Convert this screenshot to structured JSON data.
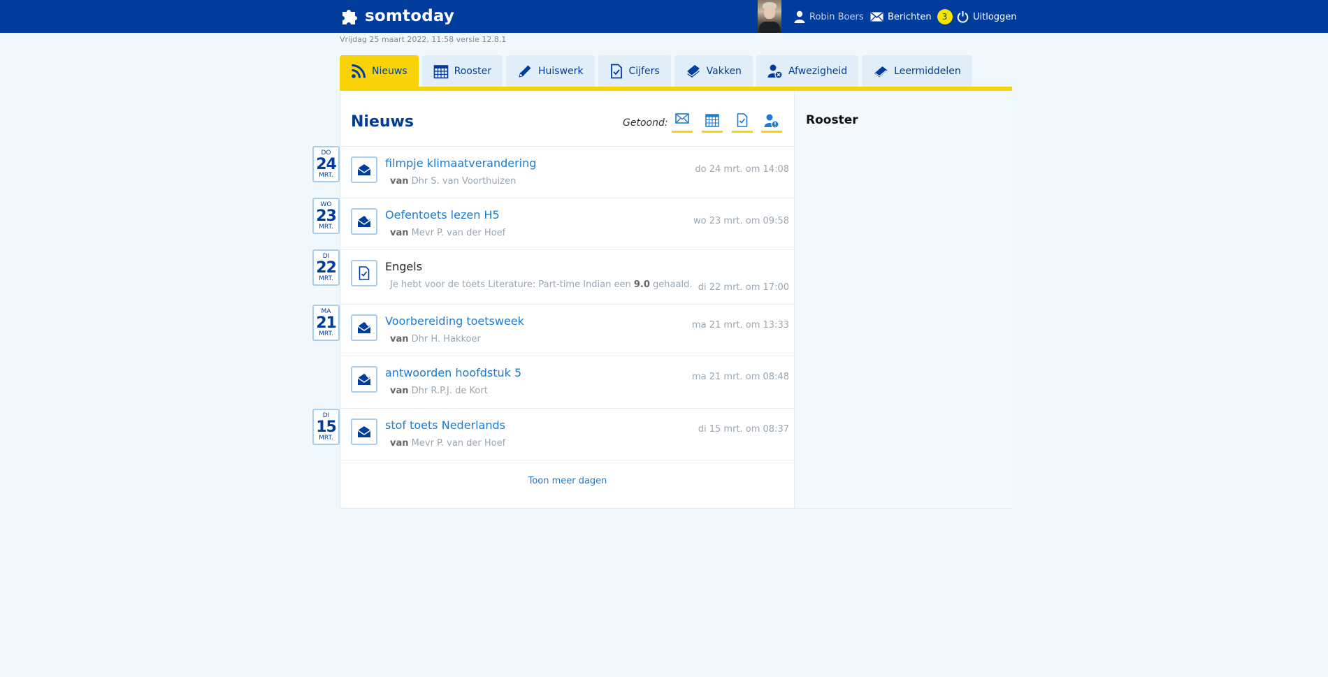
{
  "app": {
    "brand": "somtoday",
    "colors": {
      "primary": "#003c9c",
      "accent": "#f7d307",
      "link": "#1b7ad2",
      "background": "#f1f8fc"
    }
  },
  "header": {
    "user_name": "Robin Boers",
    "messages_label": "Berichten",
    "messages_count": "3",
    "logout_label": "Uitloggen",
    "icons": {
      "user": "user-icon",
      "messages": "envelope-icon",
      "logout": "power-icon"
    }
  },
  "meta_line": "Vrijdag 25 maart 2022, 11:58 versie 12.8.1",
  "tabs": [
    {
      "label": "Nieuws",
      "icon": "rss-icon",
      "active": true
    },
    {
      "label": "Rooster",
      "icon": "calendar-icon",
      "active": false
    },
    {
      "label": "Huiswerk",
      "icon": "pencil-icon",
      "active": false
    },
    {
      "label": "Cijfers",
      "icon": "grade-doc-icon",
      "active": false
    },
    {
      "label": "Vakken",
      "icon": "books-icon",
      "active": false
    },
    {
      "label": "Afwezigheid",
      "icon": "absence-icon",
      "active": false
    },
    {
      "label": "Leermiddelen",
      "icon": "book-icon",
      "active": false
    }
  ],
  "news": {
    "title": "Nieuws",
    "shown_label": "Getoond:",
    "filters": [
      "envelope-icon",
      "calendar-icon",
      "grade-doc-icon",
      "absence-icon"
    ],
    "items": [
      {
        "title": "filmpje klimaatverandering",
        "from_prefix": "van",
        "from": "Dhr S. van Voorthuizen",
        "time": "do 24 mrt. om 14:08",
        "icon": "open-envelope-icon"
      },
      {
        "title": "Oefentoets lezen H5",
        "from_prefix": "van",
        "from": "Mevr P. van der Hoef",
        "time": "wo 23 mrt. om 09:58",
        "icon": "envelope-attachment-icon"
      },
      {
        "title": "Engels",
        "text_before": "Je hebt voor de toets Literature: Part-time Indian een ",
        "grade": "9.0",
        "text_after": " gehaald.",
        "time": "di 22 mrt. om 17:00",
        "icon": "grade-doc-icon"
      },
      {
        "title": "Voorbereiding toetsweek",
        "from_prefix": "van",
        "from": "Dhr H. Hakkoer",
        "time": "ma 21 mrt. om 13:33",
        "icon": "envelope-attachment-icon"
      },
      {
        "title": "antwoorden hoofdstuk 5",
        "from_prefix": "van",
        "from": "Dhr R.P.J. de Kort",
        "time": "ma 21 mrt. om 08:48",
        "icon": "envelope-attachment-icon"
      },
      {
        "title": "stof toets Nederlands",
        "from_prefix": "van",
        "from": "Mevr P. van der Hoef",
        "time": "di 15 mrt. om 08:37",
        "icon": "open-envelope-icon"
      }
    ],
    "more_label": "Toon meer dagen"
  },
  "dates": [
    {
      "dow": "DO",
      "day": "24",
      "month": "MRT."
    },
    {
      "dow": "WO",
      "day": "23",
      "month": "MRT."
    },
    {
      "dow": "DI",
      "day": "22",
      "month": "MRT."
    },
    {
      "dow": "MA",
      "day": "21",
      "month": "MRT."
    },
    {
      "dow": "DI",
      "day": "15",
      "month": "MRT."
    }
  ],
  "sidebar": {
    "title": "Rooster"
  }
}
